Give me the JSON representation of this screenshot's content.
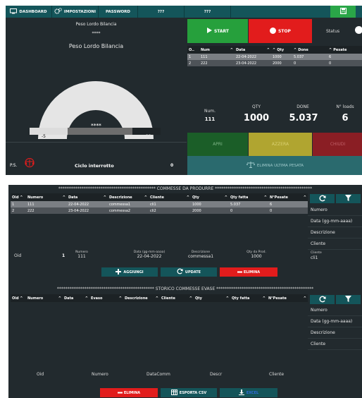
{
  "nav": {
    "dashboard": "DASHBOARD",
    "impostazioni": "IMPOSTAZIONI",
    "password": "PASSWORD",
    "tab4": "???",
    "tab5": "???"
  },
  "gauge": {
    "title_small": "Peso Lordo Bilancia",
    "masked_small": "****",
    "title_big": "Peso Lordo Bilancia",
    "masked_value": "****",
    "min": "-5",
    "max": "22"
  },
  "footer_left": {
    "ps": "P.S.",
    "status": "Ciclo interrotto",
    "count": "0"
  },
  "controls": {
    "start": "START",
    "stop": "STOP",
    "status": "Status"
  },
  "loads_table": {
    "headers": [
      "O..",
      "Num",
      "Data",
      "Qty",
      "Done",
      "Pesate"
    ],
    "rows": [
      [
        "1",
        "111",
        "22-04-2022",
        "1000",
        "5.037",
        "6"
      ],
      [
        "2",
        "222",
        "23-04-2022",
        "2000",
        "0",
        "0"
      ]
    ]
  },
  "kpi": {
    "num_label": "Num.",
    "num_value": "111",
    "qty_label": "QTY",
    "qty_value": "1000",
    "done_label": "DONE",
    "done_value": "5.037",
    "loads_label": "N° loads",
    "loads_value": "6"
  },
  "actions_top": {
    "apri": "APRI",
    "azzera": "AZZERA",
    "chiudi": "CHIUDI",
    "elimina_pesata": "ELIMINA ULTIMA PESATA"
  },
  "commesse": {
    "header": "********************************************** COMMESSE DA PRODURRE **********************************************",
    "columns": [
      "Oid",
      "Numero",
      "Data",
      "Descrizione",
      "Cliente",
      "Qty",
      "Qty fatta",
      "N°Pesate"
    ],
    "rows": [
      [
        "1",
        "111",
        "22-04-2022",
        "commessa1",
        "cli1",
        "1000",
        "5.037",
        "6"
      ],
      [
        "2",
        "222",
        "23-04-2022",
        "commessa2",
        "cli2",
        "2000",
        "0",
        "0"
      ]
    ],
    "side": [
      "Numero",
      "Data (gg-mm-aaaa)",
      "Descrizione",
      "Cliente"
    ],
    "side_cliente_label": "Cliente",
    "side_cliente_value": "cli1",
    "detail": {
      "oid_label": "Oid",
      "oid_value": "1",
      "numero_label": "Numero",
      "numero_value": "111",
      "data_label": "Data (gg-mm-aaaa)",
      "data_value": "22-04-2022",
      "desc_label": "Descrizione",
      "desc_value": "commessa1",
      "qty_label": "Qty da Prod.",
      "qty_value": "1000"
    },
    "buttons": {
      "aggiungi": "AGGIUNGI",
      "update": "UPDATE",
      "elimina": "ELIMINA"
    }
  },
  "storico": {
    "header": "********************************************** STORICO COMMESSE EVASE **********************************************",
    "columns": [
      "Oid",
      "Numero",
      "Data",
      "Evaso",
      "Descrizione",
      "Cliente",
      "Qty",
      "Qty fatta",
      "N°Pesate"
    ],
    "side": [
      "Numero",
      "Data (gg-mm-aaaa)",
      "Descrizione",
      "Cliente"
    ],
    "bottom_fields": [
      "Oid",
      "Numero",
      "DataComm",
      "Descr",
      "Cliente"
    ],
    "buttons": {
      "elimina": "ELIMINA",
      "esporta": "ESPORTA CSV",
      "third": "EXCEL"
    }
  },
  "colors": {
    "panel_bg": "#222a2e",
    "nav_bg": "#14555a",
    "start": "#26a03c",
    "stop": "#e21c1c",
    "elimina": "#e21c1c",
    "azzera": "#b0a530",
    "chiudi": "#8a1e24"
  }
}
